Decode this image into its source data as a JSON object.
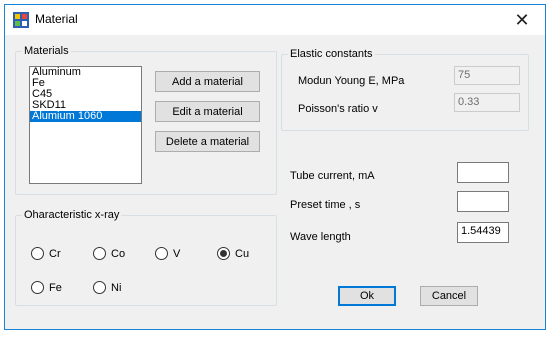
{
  "window": {
    "title": "Material",
    "close_glyph": "✕"
  },
  "materials": {
    "legend": "Materials",
    "items": [
      {
        "label": "Aluminum",
        "selected": false
      },
      {
        "label": "Fe",
        "selected": false
      },
      {
        "label": "C45",
        "selected": false
      },
      {
        "label": "SKD11",
        "selected": false
      },
      {
        "label": "Alumium 1060",
        "selected": true
      }
    ],
    "add_label": "Add a material",
    "edit_label": "Edit a material",
    "delete_label": "Delete a material"
  },
  "elastic": {
    "legend": "Elastic constants",
    "young_label": "Modun Young E, MPa",
    "young_value": "75",
    "poisson_label": "Poisson's ratio v",
    "poisson_value": "0.33"
  },
  "xray": {
    "legend": "Oharacteristic x-ray",
    "options": [
      {
        "label": "Cr",
        "checked": false
      },
      {
        "label": "Co",
        "checked": false
      },
      {
        "label": "V",
        "checked": false
      },
      {
        "label": "Cu",
        "checked": true
      },
      {
        "label": "Fe",
        "checked": false
      },
      {
        "label": "Ni",
        "checked": false
      }
    ]
  },
  "params": {
    "tube_label": "Tube current, mA",
    "tube_value": "",
    "preset_label": "Preset time , s",
    "preset_value": "",
    "wave_label": "Wave length",
    "wave_value": "1.54439"
  },
  "dialog": {
    "ok_label": "Ok",
    "cancel_label": "Cancel"
  },
  "colors": {
    "accent": "#0078d7",
    "window_border": "#1883d7"
  }
}
